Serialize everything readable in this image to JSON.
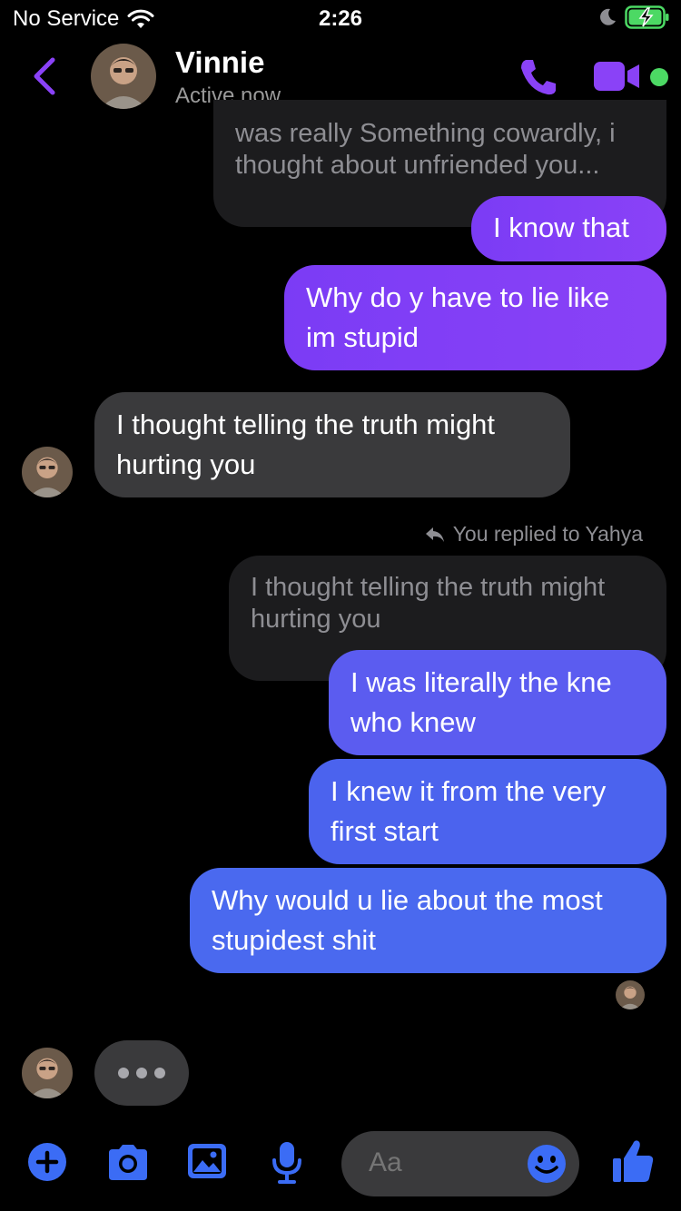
{
  "status_bar": {
    "carrier": "No Service",
    "time": "2:26"
  },
  "header": {
    "name": "Vinnie",
    "status": "Active now"
  },
  "messages": {
    "quoted_top": "was really Something cowardly, i thought about unfriended you...",
    "m1": "I know that",
    "m2": "Why do y have to lie like im stupid",
    "m3": "I thought telling the truth might hurting you",
    "reply_note": "You replied to Yahya",
    "quoted_reply": "I thought telling the truth might hurting you",
    "m4": "I was literally the kne who knew",
    "m5": "I knew it from the very first start",
    "m6": "Why would u lie about the most stupidest shit"
  },
  "composer": {
    "placeholder": "Aa"
  },
  "colors": {
    "accent_purple": "#8a42f7",
    "sent_blue": "#4b63ee",
    "online_green": "#4cd964"
  }
}
